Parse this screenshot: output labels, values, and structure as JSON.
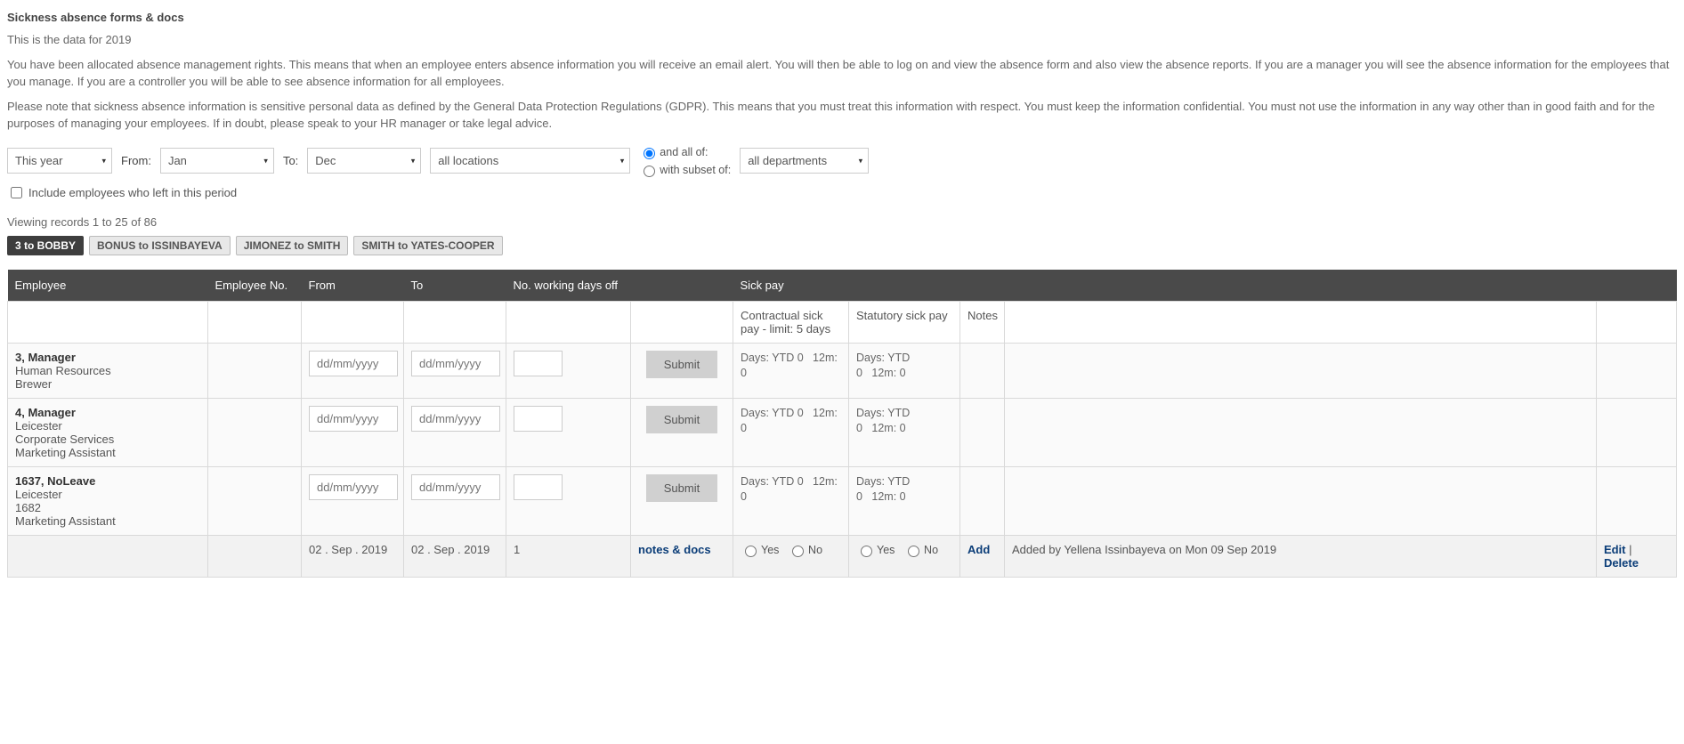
{
  "title": "Sickness absence forms & docs",
  "intro_year": "This is the data for 2019",
  "intro_rights": "You have been allocated absence management rights. This means that when an employee enters absence information you will receive an email alert. You will then be able to log on and view the absence form and also view the absence reports. If you are a manager you will see the absence information for the employees that you manage. If you are a controller you will be able to see absence information for all employees.",
  "intro_gdpr": "Please note that sickness absence information is sensitive personal data as defined by the General Data Protection Regulations (GDPR). This means that you must treat this information with respect. You must keep the information confidential. You must not use the information in any way other than in good faith and for the purposes of managing your employees. If in doubt, please speak to your HR manager or take legal advice.",
  "filters": {
    "period": "This year",
    "from_label": "From:",
    "from_month": "Jan",
    "to_label": "To:",
    "to_month": "Dec",
    "location": "all locations",
    "and_all_of": "and all of:",
    "with_subset_of": "with subset of:",
    "department": "all departments",
    "include_left": "Include employees who left in this period"
  },
  "viewing": "Viewing records 1 to 25 of 86",
  "pager": {
    "active": "3 to BOBBY",
    "items": [
      "BONUS to ISSINBAYEVA",
      "JIMONEZ to SMITH",
      "SMITH to YATES-COOPER"
    ]
  },
  "headers": {
    "employee": "Employee",
    "employee_no": "Employee No.",
    "from": "From",
    "to": "To",
    "days_off": "No. working days off",
    "sick_pay": "Sick pay",
    "contractual": "Contractual sick pay - limit: 5 days",
    "statutory": "Statutory sick pay",
    "notes": "Notes"
  },
  "placeholders": {
    "date": "dd/mm/yyyy"
  },
  "buttons": {
    "submit": "Submit",
    "add": "Add",
    "edit": "Edit",
    "delete": "Delete",
    "notes_docs": "notes & docs"
  },
  "sick_text": {
    "ytd": "Days: YTD 0",
    "m12": "12m: 0"
  },
  "yesno": {
    "yes": "Yes",
    "no": "No"
  },
  "rows": [
    {
      "name": "3, Manager",
      "lines": [
        "Human Resources",
        "Brewer"
      ]
    },
    {
      "name": "4, Manager",
      "lines": [
        "Leicester",
        "Corporate Services",
        "Marketing Assistant"
      ]
    },
    {
      "name": "1637, NoLeave",
      "lines": [
        "Leicester",
        "1682",
        "Marketing Assistant"
      ]
    }
  ],
  "existing": {
    "from": "02 . Sep . 2019",
    "to": "02 . Sep . 2019",
    "days": "1",
    "note": "Added by Yellena Issinbayeva on Mon 09 Sep 2019"
  }
}
